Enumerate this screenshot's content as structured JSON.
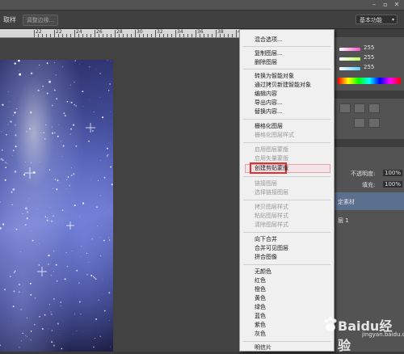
{
  "toolbar": {
    "label": "取样",
    "refine_edge": "调整边缘...",
    "workspace": "基本功能",
    "workspace_arrow": "▾"
  },
  "ruler": {
    "ticks": [
      "22",
      "22",
      "24",
      "26",
      "28",
      "30",
      "32",
      "34",
      "36",
      "38",
      "40"
    ]
  },
  "panels": {
    "values": [
      "255",
      "255",
      "255"
    ],
    "opacity_label": "不透明度:",
    "opacity_value": "100%",
    "fill_label": "填充:",
    "fill_value": "100%",
    "layer_name_1": "定素材",
    "layer_name_2": "层 1",
    "colors": {
      "r_bar": "#ff4fd0",
      "g_bar": "#b8ff5a",
      "b_bar": "#5ad0ff"
    }
  },
  "context_menu": {
    "items": [
      {
        "label": "混合选项...",
        "enabled": true
      },
      {
        "label": "复制图层...",
        "enabled": true
      },
      {
        "label": "删除图层",
        "enabled": true
      },
      {
        "label": "转换为智能对象",
        "enabled": true
      },
      {
        "label": "通过拷贝新建智能对象",
        "enabled": true
      },
      {
        "label": "编辑内容",
        "enabled": true
      },
      {
        "label": "导出内容...",
        "enabled": true
      },
      {
        "label": "替换内容...",
        "enabled": true
      },
      {
        "label": "栅格化图层",
        "enabled": true
      },
      {
        "label": "栅格化图层样式",
        "enabled": false
      },
      {
        "label": "启用图层蒙版",
        "enabled": false
      },
      {
        "label": "启用矢量蒙版",
        "enabled": false
      },
      {
        "label": "创建剪贴蒙版",
        "enabled": true,
        "highlighted": true
      },
      {
        "label": "链接图层",
        "enabled": false
      },
      {
        "label": "选择链接图层",
        "enabled": false
      },
      {
        "label": "拷贝图层样式",
        "enabled": false
      },
      {
        "label": "粘贴图层样式",
        "enabled": false
      },
      {
        "label": "清除图层样式",
        "enabled": false
      },
      {
        "label": "向下合并",
        "enabled": true
      },
      {
        "label": "合并可见图层",
        "enabled": true
      },
      {
        "label": "拼合图像",
        "enabled": true
      },
      {
        "label": "无颜色",
        "enabled": true
      },
      {
        "label": "红色",
        "enabled": true
      },
      {
        "label": "橙色",
        "enabled": true
      },
      {
        "label": "黄色",
        "enabled": true
      },
      {
        "label": "绿色",
        "enabled": true
      },
      {
        "label": "蓝色",
        "enabled": true
      },
      {
        "label": "紫色",
        "enabled": true
      },
      {
        "label": "灰色",
        "enabled": true
      },
      {
        "label": "明信片",
        "enabled": true
      }
    ]
  },
  "watermark": {
    "brand": "Baidu",
    "suffix": "经验",
    "url": "jingyan.baidu.com"
  },
  "accent": {
    "highlight_border": "#e03030"
  }
}
